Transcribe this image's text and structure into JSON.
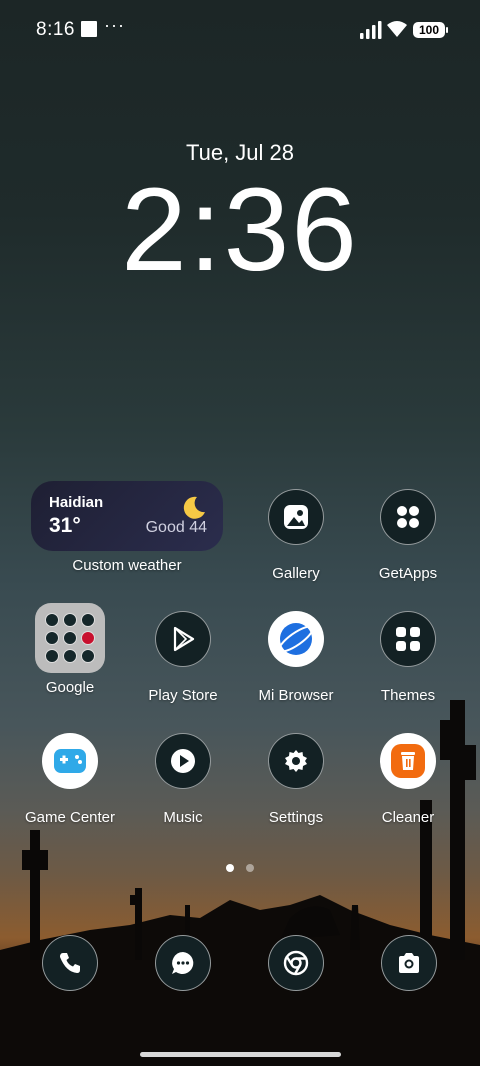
{
  "status_bar": {
    "time": "8:16",
    "more": "···",
    "battery": "100"
  },
  "clock": {
    "date": "Tue, Jul 28",
    "time": "2:36"
  },
  "weather": {
    "city": "Haidian",
    "temp": "31°",
    "aqi": "Good 44",
    "widget_label": "Custom weather"
  },
  "apps": {
    "gallery": "Gallery",
    "getapps": "GetApps",
    "google": "Google",
    "play_store": "Play Store",
    "mi_browser": "Mi Browser",
    "themes": "Themes",
    "game_center": "Game Center",
    "music": "Music",
    "settings": "Settings",
    "cleaner": "Cleaner"
  },
  "dock": [
    "phone-icon",
    "messages-icon",
    "chrome-icon",
    "camera-icon"
  ],
  "pager": {
    "pages": 2,
    "active": 1
  },
  "colors": {
    "cleaner_orange": "#f26b0f",
    "browser_blue": "#1e6fe0",
    "game_center_blue": "#2fa9e8"
  }
}
